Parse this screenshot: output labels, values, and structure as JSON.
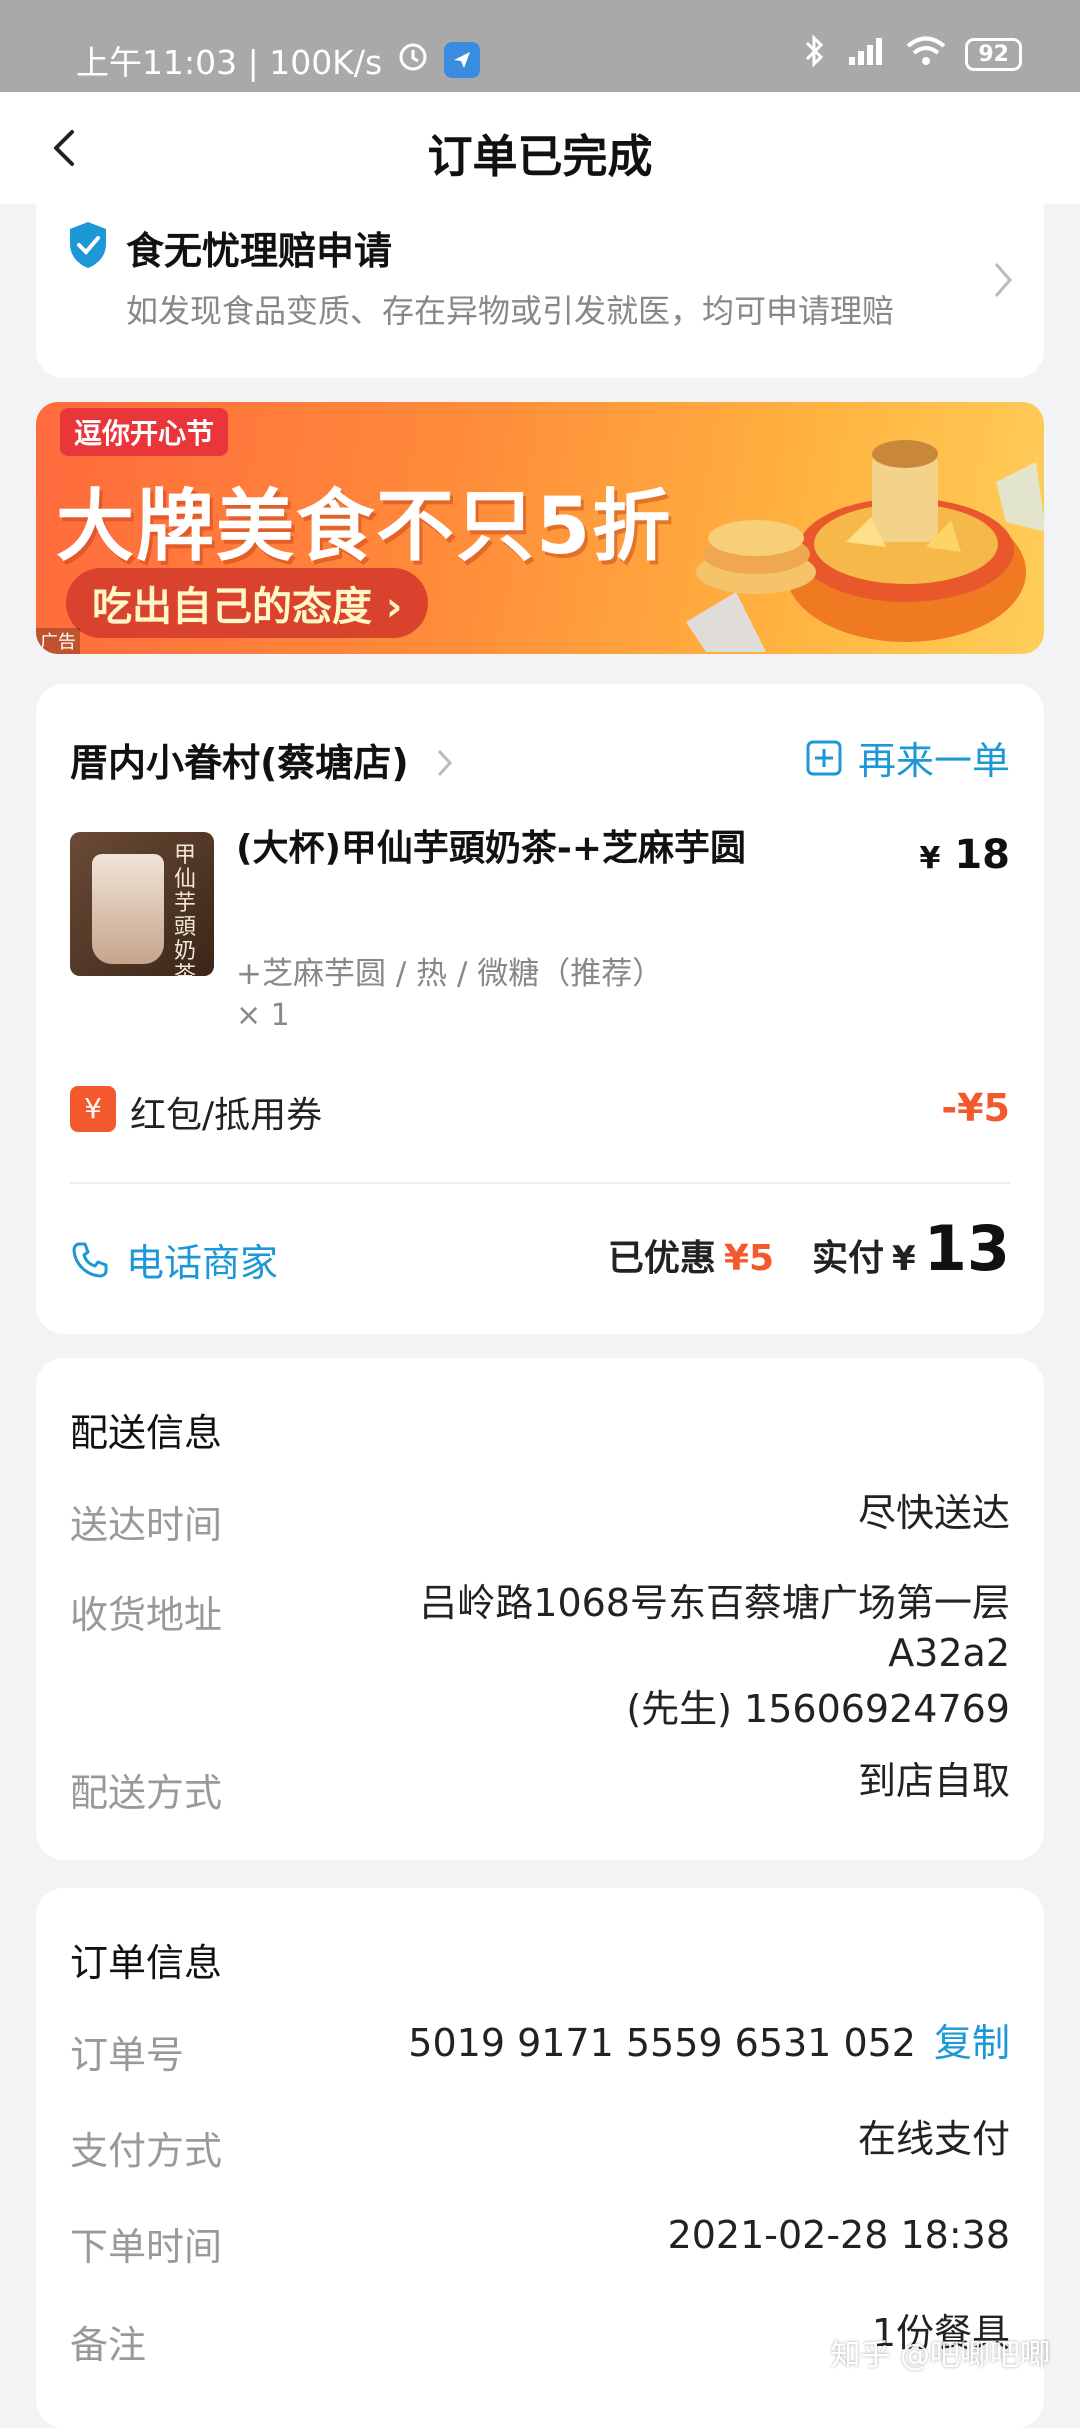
{
  "status_bar": {
    "time": "上午11:03 | 100K/s",
    "battery": "92"
  },
  "nav": {
    "title": "订单已完成"
  },
  "insurance": {
    "title": "食无忧理赔申请",
    "desc": "如发现食品变质、存在异物或引发就医，均可申请理赔"
  },
  "banner": {
    "tag": "逗你开心节",
    "headline": "大牌美食不只5折",
    "button": "吃出自己的态度 ›",
    "ad": "广告"
  },
  "order": {
    "shop_name": "厝内小眷村(蔡塘店)",
    "reorder": "再来一单",
    "item": {
      "image_text": "甲仙芋頭奶茶",
      "name": "(大杯)甲仙芋頭奶茶-+芝麻芋圆",
      "price_symbol": "¥",
      "price": "18",
      "spec": "+芝麻芋圆 / 热 / 微糖（推荐）",
      "qty": "× 1"
    },
    "coupon": {
      "icon": "¥",
      "label": "红包/抵用券",
      "value": "-¥5"
    },
    "call": "电话商家",
    "discount_label": "已优惠",
    "discount_value": "¥5",
    "paid_label": "实付",
    "paid_symbol": "¥",
    "paid_value": "13"
  },
  "delivery": {
    "title": "配送信息",
    "time_label": "送达时间",
    "time_value": "尽快送达",
    "address_label": "收货地址",
    "address_line1": "吕岭路1068号东百蔡塘广场第一层",
    "address_line2": "A32a2",
    "address_line3": "(先生) 15606924769",
    "method_label": "配送方式",
    "method_value": "到店自取"
  },
  "order_info": {
    "title": "订单信息",
    "number_label": "订单号",
    "number_value": "5019 9171 5559 6531 052",
    "copy": "复制",
    "pay_label": "支付方式",
    "pay_value": "在线支付",
    "time_label": "下单时间",
    "time_value": "2021-02-28 18:38",
    "note_label": "备注",
    "note_value": "1份餐具"
  },
  "watermark": "知乎 @吧唧吧唧",
  "colors": {
    "accent_blue": "#1c98d6",
    "accent_orange": "#f4592e"
  }
}
